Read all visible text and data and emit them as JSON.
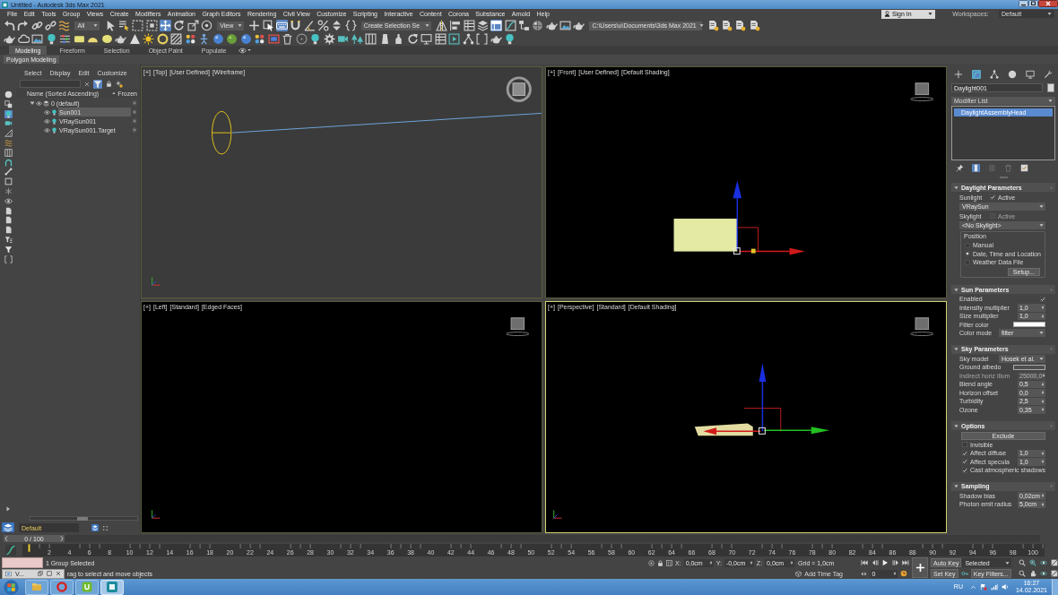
{
  "window": {
    "title": "Untitled - Autodesk 3ds Max 2021"
  },
  "menu": [
    "File",
    "Edit",
    "Tools",
    "Group",
    "Views",
    "Create",
    "Modifiers",
    "Animation",
    "Graph Editors",
    "Rendering",
    "Civil View",
    "Customize",
    "Scripting",
    "Interactive",
    "Content",
    "Corona",
    "Substance",
    "Arnold",
    "Help"
  ],
  "account": {
    "sign_in": "Sign In",
    "workspaces_label": "Workspaces:",
    "workspace": "Default"
  },
  "main_toolbar": [
    {
      "kind": "tool",
      "selected": false
    },
    {
      "kind": "tool",
      "selected": false
    },
    {
      "kind": "tool",
      "selected": false
    },
    {
      "kind": "tool",
      "selected": false
    },
    {
      "kind": "tool",
      "selected": false
    },
    {
      "kind": "dropdown",
      "value": "All"
    },
    {
      "kind": "tool",
      "selected": false
    },
    {
      "kind": "tool",
      "selected": false
    },
    {
      "kind": "tool",
      "selected": false
    },
    {
      "kind": "tool",
      "selected": false
    },
    {
      "kind": "tool",
      "selected": true
    },
    {
      "kind": "tool",
      "selected": false
    },
    {
      "kind": "tool",
      "selected": false
    },
    {
      "kind": "tool",
      "selected": false
    },
    {
      "kind": "dropdown",
      "value": "View"
    },
    {
      "kind": "tool",
      "selected": false
    },
    {
      "kind": "tool",
      "selected": false
    },
    {
      "kind": "tool",
      "selected": true
    },
    {
      "kind": "tool",
      "selected": false
    },
    {
      "kind": "tool",
      "selected": false
    },
    {
      "kind": "tool",
      "selected": false
    },
    {
      "kind": "tool",
      "selected": false
    },
    {
      "kind": "tool",
      "selected": false
    },
    {
      "kind": "dropdown",
      "value": "Create Selection Se"
    },
    {
      "kind": "tool",
      "selected": false
    },
    {
      "kind": "tool",
      "selected": false
    },
    {
      "kind": "tool",
      "selected": false
    },
    {
      "kind": "tool",
      "selected": false
    },
    {
      "kind": "tool",
      "selected": true
    },
    {
      "kind": "tool",
      "selected": false
    },
    {
      "kind": "tool",
      "selected": false
    },
    {
      "kind": "tool",
      "selected": false
    },
    {
      "kind": "tool",
      "selected": false
    },
    {
      "kind": "tool",
      "selected": false
    },
    {
      "kind": "tool",
      "selected": false
    },
    {
      "kind": "dropdown",
      "value": "C:\\Users\\u\\Documents\\3ds Max 2021"
    },
    {
      "kind": "tool",
      "selected": false
    },
    {
      "kind": "tool",
      "selected": false
    },
    {
      "kind": "tool",
      "selected": false
    },
    {
      "kind": "tool",
      "selected": false
    }
  ],
  "ribbon": {
    "tabs": [
      {
        "label": "Modeling",
        "selected": true
      },
      {
        "label": "Freeform",
        "selected": false
      },
      {
        "label": "Selection",
        "selected": false
      },
      {
        "label": "Object Paint",
        "selected": false
      },
      {
        "label": "Populate",
        "selected": false
      }
    ],
    "panel": "Polygon Modeling"
  },
  "scene_explorer": {
    "filters": [
      {
        "selected": false
      },
      {
        "selected": false
      },
      {
        "selected": true
      },
      {
        "selected": false
      },
      {
        "selected": false
      },
      {
        "selected": false
      },
      {
        "selected": false
      },
      {
        "selected": false
      },
      {
        "selected": false
      },
      {
        "selected": false
      },
      {
        "selected": false
      },
      {
        "selected": false
      },
      {
        "selected": false
      },
      {
        "selected": false
      },
      {
        "selected": false
      },
      {
        "selected": false
      },
      {
        "selected": false
      },
      {
        "selected": false
      }
    ],
    "menu": [
      "Select",
      "Display",
      "Edit",
      "Customize"
    ],
    "filter_on": true,
    "columns": [
      "Name (Sorted Ascending)",
      "Frozen"
    ],
    "tree": [
      {
        "kind": "layer",
        "name": "0 (default)",
        "selected": false,
        "expanded": true,
        "children": [
          {
            "kind": "light",
            "name": "Sun001",
            "selected": true
          },
          {
            "kind": "light",
            "name": "VRaySun001",
            "selected": false
          },
          {
            "kind": "light",
            "name": "VRaySun001.Target",
            "selected": false
          }
        ]
      }
    ],
    "layer": "Default"
  },
  "viewports": [
    {
      "kind": "top",
      "labels": [
        "[+]",
        "[Top]",
        "[User Defined]",
        "[Wireframe]"
      ],
      "selected": false
    },
    {
      "kind": "front",
      "labels": [
        "[+]",
        "[Front]",
        "[User Defined]",
        "[Default Shading]"
      ],
      "selected": false
    },
    {
      "kind": "left",
      "labels": [
        "[+]",
        "[Left]",
        "[Standard]",
        "[Edged Faces]"
      ],
      "selected": false
    },
    {
      "kind": "perspective",
      "labels": [
        "[+]",
        "[Perspective]",
        "[Standard]",
        "[Default Shading]"
      ],
      "selected": true
    }
  ],
  "command_panel": {
    "tabs": [
      {
        "selected": false
      },
      {
        "selected": true
      },
      {
        "selected": false
      },
      {
        "selected": false
      },
      {
        "selected": false
      },
      {
        "selected": false
      }
    ],
    "object": {
      "name": "Daylight001",
      "color": "#d9d9d9"
    },
    "modifier_list": "Modifier List",
    "stack": [
      {
        "label": "DaylightAssemblyHead",
        "selected": true
      }
    ],
    "stack_tools": [
      {
        "selected": false
      },
      {
        "selected": true
      },
      {
        "selected": false
      },
      {
        "selected": false
      },
      {
        "selected": false
      }
    ],
    "rollouts": [
      {
        "title": "Daylight Parameters",
        "expanded": true,
        "rows": [
          {
            "kind": "check_pair",
            "label": "Sunlight",
            "check": "Active",
            "checked": true,
            "disabled": false
          },
          {
            "kind": "dropdown",
            "value": "VRaySun"
          },
          {
            "kind": "check_pair",
            "label": "Skylight",
            "check": "Active",
            "checked": false,
            "disabled": true
          },
          {
            "kind": "dropdown",
            "value": "<No Skylight>"
          },
          {
            "kind": "group",
            "title": "Position",
            "rows": [
              {
                "kind": "radio",
                "label": "Manual",
                "selected": false
              },
              {
                "kind": "radio",
                "label": "Date, Time and Location",
                "selected": true
              },
              {
                "kind": "radio",
                "label": "Weather Data File",
                "selected": false
              },
              {
                "kind": "button",
                "label": "Setup..."
              }
            ]
          }
        ]
      },
      {
        "title": "Sun Parameters",
        "expanded": true,
        "rows": [
          {
            "kind": "check_right",
            "label": "Enabled",
            "checked": true
          },
          {
            "kind": "spinner",
            "label": "Intensity multiplier",
            "value": "1,0"
          },
          {
            "kind": "spinner",
            "label": "Size multiplier",
            "value": "1,0"
          },
          {
            "kind": "swatch",
            "label": "Filter color",
            "color": "#ffffff"
          },
          {
            "kind": "select",
            "label": "Color mode",
            "value": "filter"
          }
        ]
      },
      {
        "title": "Sky Parameters",
        "expanded": true,
        "rows": [
          {
            "kind": "select",
            "label": "Sky model",
            "value": "Hosek et al."
          },
          {
            "kind": "swatch",
            "label": "Ground albedo",
            "color": "#4f4f4f"
          },
          {
            "kind": "spinner",
            "label": "Indirect horiz illum",
            "value": "25000,0",
            "disabled": true
          },
          {
            "kind": "spinner",
            "label": "Blend angle",
            "value": "0,5"
          },
          {
            "kind": "spinner",
            "label": "Horizon offset",
            "value": "0,0"
          },
          {
            "kind": "spinner",
            "label": "Turbidity",
            "value": "2,5"
          },
          {
            "kind": "spinner",
            "label": "Ozone",
            "value": "0,35"
          }
        ]
      },
      {
        "title": "Options",
        "expanded": true,
        "rows": [
          {
            "kind": "button",
            "label": "Exclude"
          },
          {
            "kind": "check",
            "label": "Invisible",
            "checked": false
          },
          {
            "kind": "check",
            "label": "Affect diffuse",
            "checked": true,
            "value": "1,0"
          },
          {
            "kind": "check",
            "label": "Affect specula",
            "checked": true,
            "value": "1,0"
          },
          {
            "kind": "check",
            "label": "Cast atmospheric shadows",
            "checked": true
          }
        ]
      },
      {
        "title": "Sampling",
        "expanded": true,
        "rows": [
          {
            "kind": "spinner",
            "label": "Shadow bias",
            "value": "0,02cm"
          },
          {
            "kind": "spinner",
            "label": "Photon emit radius",
            "value": "5,0cm"
          }
        ]
      }
    ]
  },
  "timeline": {
    "time_slider": {
      "label": "0 / 100",
      "level": 0
    },
    "ticks": [
      "2",
      "4",
      "6",
      "8",
      "10",
      "12",
      "14",
      "16",
      "18",
      "20",
      "22",
      "24",
      "26",
      "28",
      "30",
      "32",
      "34",
      "36",
      "38",
      "40",
      "42",
      "44",
      "46",
      "48",
      "50",
      "52",
      "54",
      "56",
      "58",
      "60",
      "62",
      "64",
      "66",
      "68",
      "70",
      "72",
      "74",
      "76",
      "78",
      "80",
      "82",
      "84",
      "86",
      "88",
      "90",
      "92",
      "94",
      "96",
      "98",
      "100"
    ]
  },
  "status": {
    "selection": "1 Group Selected",
    "floating_window": "V...",
    "prompt": "rag to select and move objects",
    "coordinates": [
      {
        "axis": "X:",
        "value": "0,0cm"
      },
      {
        "axis": "Y:",
        "value": "-0,0cm"
      },
      {
        "axis": "Z:",
        "value": "0,0cm"
      }
    ],
    "grid": "Grid = 1,0cm",
    "time_tag": "Add Time Tag"
  },
  "animation": {
    "frame": "0",
    "auto_key": "Auto Key",
    "key_set": "Selected",
    "set_key": "Set Key",
    "key_filters": "Key Filters..."
  },
  "taskbar": {
    "apps": [
      {
        "selected": false
      },
      {
        "selected": false
      },
      {
        "selected": false
      },
      {
        "selected": true
      }
    ],
    "language": "RU",
    "time": "16:27",
    "date": "14.02.2021"
  }
}
